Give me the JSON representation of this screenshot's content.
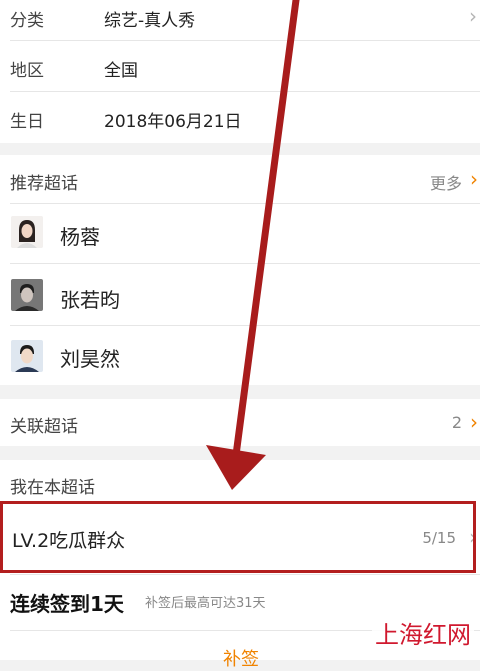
{
  "info": {
    "category_label": "分类",
    "category_value": "综艺-真人秀",
    "region_label": "地区",
    "region_value": "全国",
    "birthday_label": "生日",
    "birthday_value": "2018年06月21日"
  },
  "recommended": {
    "title": "推荐超话",
    "more": "更多",
    "items": [
      {
        "name": "杨蓉",
        "avatar": "avatar-woman"
      },
      {
        "name": "张若昀",
        "avatar": "avatar-man"
      },
      {
        "name": "刘昊然",
        "avatar": "avatar-young-man"
      }
    ]
  },
  "related": {
    "title": "关联超话",
    "count": "2"
  },
  "mine": {
    "title": "我在本超话",
    "level": "LV.2吃瓜群众",
    "progress": "5/15",
    "checkin": "连续签到1天",
    "checkin_hint": "补签后最高可达31天",
    "makeup": "补签"
  },
  "watermark": "上海红网",
  "colors": {
    "accent": "#f08300",
    "highlight_box": "#b31e1e",
    "arrow": "#a81c1c"
  }
}
